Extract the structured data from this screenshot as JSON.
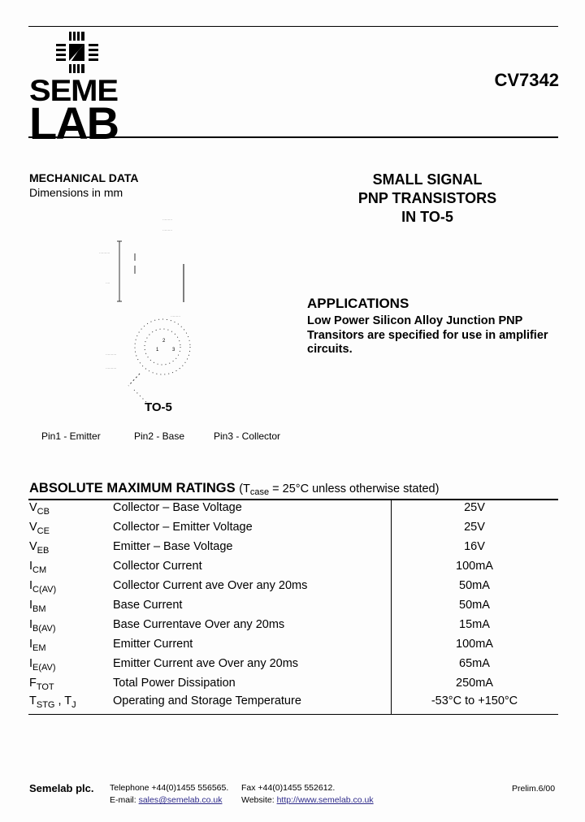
{
  "header": {
    "logo_top": "SEME",
    "logo_bottom": "LAB",
    "part_number": "CV7342"
  },
  "mechanical": {
    "title": "MECHANICAL DATA",
    "subtitle": "Dimensions in mm",
    "package_label": "TO-5",
    "pins": [
      "Pin1 - Emitter",
      "Pin2 - Base",
      "Pin3 - Collector"
    ]
  },
  "product": {
    "lines": [
      "SMALL SIGNAL",
      "PNP TRANSISTORS",
      "IN TO-5"
    ]
  },
  "applications": {
    "title": "APPLICATIONS",
    "body": "Low Power Silicon Alloy Junction PNP Transitors are specified for use in amplifier circuits."
  },
  "ratings": {
    "title": "ABSOLUTE MAXIMUM RATINGS",
    "condition_prefix": "(T",
    "condition_sub": "case",
    "condition_suffix": " = 25°C unless otherwise stated)",
    "rows": [
      {
        "sym": "V",
        "sub": "CB",
        "desc": "Collector – Base Voltage",
        "value": "25V"
      },
      {
        "sym": "V",
        "sub": "CE",
        "desc": "Collector – Emitter Voltage",
        "value": "25V"
      },
      {
        "sym": "V",
        "sub": "EB",
        "desc": "Emitter – Base Voltage",
        "value": "16V"
      },
      {
        "sym": "I",
        "sub": "CM",
        "desc": "Collector Current",
        "value": "100mA"
      },
      {
        "sym": "I",
        "sub": "C(AV)",
        "desc": "Collector Current ave Over any 20ms",
        "value": "50mA"
      },
      {
        "sym": "I",
        "sub": "BM",
        "desc": "Base Current",
        "value": "50mA"
      },
      {
        "sym": "I",
        "sub": "B(AV)",
        "desc": "Base Currentave Over any 20ms",
        "value": "15mA"
      },
      {
        "sym": "I",
        "sub": "EM",
        "desc": "Emitter Current",
        "value": "100mA"
      },
      {
        "sym": "I",
        "sub": "E(AV)",
        "desc": "Emitter Current ave Over any 20ms",
        "value": "65mA"
      },
      {
        "sym": "F",
        "sub": "TOT",
        "desc": "Total Power Dissipation",
        "value": "250mA"
      },
      {
        "sym": "T",
        "sub": "STG",
        "sym2": " , T",
        "sub2": "J",
        "desc": "Operating and Storage Temperature",
        "value": "-53°C to +150°C"
      }
    ]
  },
  "footer": {
    "company": "Semelab plc.",
    "telephone": "Telephone +44(0)1455 556565.",
    "fax": "Fax +44(0)1455 552612.",
    "email_label": "E-mail: ",
    "email": "sales@semelab.co.uk",
    "website_label": "Website: ",
    "website": "http://www.semelab.co.uk",
    "revision": "Prelim.6/00"
  }
}
